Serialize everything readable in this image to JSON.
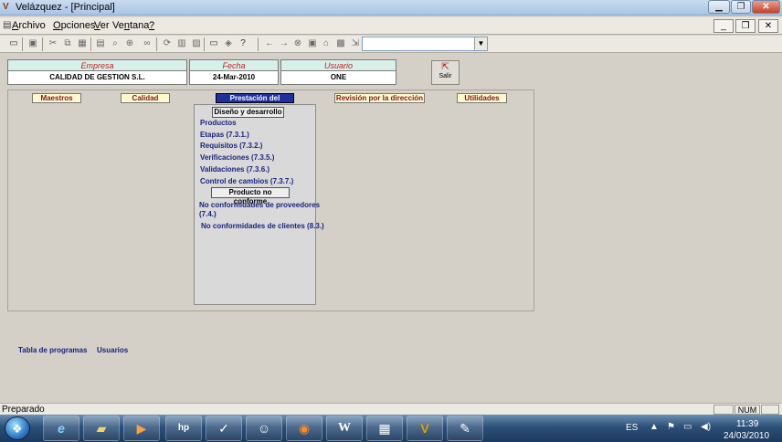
{
  "window": {
    "title": "Velázquez - [Principal]"
  },
  "menu": {
    "items": [
      {
        "label": "Archivo",
        "u": "A",
        "rest": "rchivo"
      },
      {
        "label": "Opciones",
        "u": "O",
        "rest": "pciones"
      },
      {
        "label": "Ver",
        "u": "V",
        "rest": "er"
      },
      {
        "label": "Ventana",
        "u": "n",
        "pre": "Ve",
        "rest": "tana"
      },
      {
        "label": "?",
        "u": "?",
        "rest": ""
      }
    ]
  },
  "header": {
    "empresa_label": "Empresa",
    "empresa_value": "CALIDAD DE GESTION S.L.",
    "fecha_label": "Fecha",
    "fecha_value": "24-Mar-2010",
    "usuario_label": "Usuario",
    "usuario_value": "ONE",
    "salir_label": "Salir"
  },
  "tabs": [
    {
      "label": "Maestros",
      "active": false
    },
    {
      "label": "Calidad",
      "active": false
    },
    {
      "label": "Prestación del servicio",
      "active": true
    },
    {
      "label": "Revisión por la dirección",
      "active": false
    },
    {
      "label": "Utilidades",
      "active": false
    }
  ],
  "panel": {
    "section1": "Diseño y desarrollo",
    "links1": [
      "Productos",
      "Etapas (7.3.1.)",
      "Requisitos (7.3.2.)",
      "Verificaciones (7.3.5.)",
      "Validaciones (7.3.6.)",
      "Control de cambios (7.3.7.)"
    ],
    "section2": "Producto no conforme",
    "link_prov_1": "No conformidades de proveedores",
    "link_prov_2": "(7.4.)",
    "link_cli": "No conformidades de clientes (8.3.)"
  },
  "bottom": {
    "tabla_programas": "Tabla de programas",
    "usuarios": "Usuarios"
  },
  "status": {
    "text": "Preparado",
    "num": "NUM"
  },
  "taskbar": {
    "lang": "ES",
    "time": "11:39",
    "date": "24/03/2010"
  }
}
